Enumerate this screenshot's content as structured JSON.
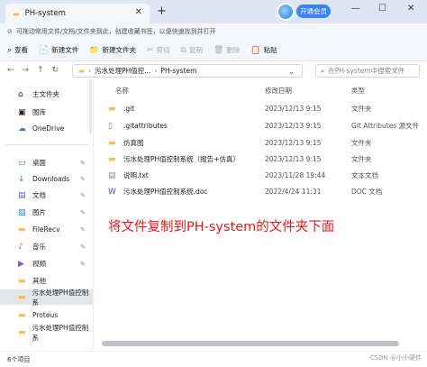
{
  "tab": {
    "title": "PH-system",
    "close": "✕",
    "new": "+"
  },
  "window": {
    "vip_button": "开通会员",
    "minimize": "—",
    "maximize": "☐",
    "close": "✕"
  },
  "banner": {
    "text": "可拖动常用文件/文档/文件夹到此，创建收藏书签，以便快速找到并打开"
  },
  "toolbar": {
    "items": [
      {
        "label": "查看",
        "icon": "⌕"
      },
      {
        "label": "新建文件",
        "icon": "📄"
      },
      {
        "label": "新建文件夹",
        "icon": "📁"
      },
      {
        "label": "剪切",
        "icon": "✂"
      },
      {
        "label": "复制",
        "icon": "⧉"
      },
      {
        "label": "删除",
        "icon": "🗑"
      },
      {
        "label": "粘贴",
        "icon": "📋"
      }
    ]
  },
  "address": {
    "crumbs": [
      "污水处理PH值控...",
      "PH-system"
    ],
    "search_placeholder": "在PH-system中搜索文件"
  },
  "sidebar": {
    "items": [
      {
        "label": "主文件夹",
        "icon": "⌂",
        "pinned": false
      },
      {
        "label": "图库",
        "icon": "▣",
        "pinned": false
      },
      {
        "label": "OneDrive",
        "icon": "☁",
        "pinned": false
      },
      {
        "label": "桌面",
        "icon": "▭",
        "pinned": true
      },
      {
        "label": "Downloads",
        "icon": "↓",
        "pinned": true
      },
      {
        "label": "文档",
        "icon": "▤",
        "pinned": true
      },
      {
        "label": "图片",
        "icon": "▨",
        "pinned": true
      },
      {
        "label": "FileRecv",
        "icon": "▬",
        "pinned": true
      },
      {
        "label": "音乐",
        "icon": "♪",
        "pinned": true
      },
      {
        "label": "视频",
        "icon": "▶",
        "pinned": true
      },
      {
        "label": "其他",
        "icon": "▬",
        "pinned": false
      },
      {
        "label": "污水处理PH值控制系",
        "icon": "▬",
        "pinned": false
      },
      {
        "label": "Proteus",
        "icon": "▬",
        "pinned": false
      },
      {
        "label": "污水处理PH值控制系",
        "icon": "▬",
        "pinned": false
      }
    ]
  },
  "columns": {
    "name": "名称",
    "date": "修改日期",
    "type": "类型"
  },
  "files": [
    {
      "name": ".git",
      "date": "2023/12/13 9:15",
      "type": "文件夹",
      "icon": "folder"
    },
    {
      "name": ".gitattributes",
      "date": "2023/12/13 9:15",
      "type": "Git Attributes 源文件",
      "icon": "file"
    },
    {
      "name": "仿真图",
      "date": "2023/12/13 9:15",
      "type": "文件夹",
      "icon": "folder"
    },
    {
      "name": "污水处理PH值控制系统（报告+仿真）",
      "date": "2023/12/13 9:15",
      "type": "文件夹",
      "icon": "folder"
    },
    {
      "name": "说明.txt",
      "date": "2023/11/28 19:44",
      "type": "文本文档",
      "icon": "file"
    },
    {
      "name": "污水处理PH值控制系统.doc",
      "date": "2022/4/24 11:31",
      "type": "DOC 文档",
      "icon": "doc"
    }
  ],
  "caption": "将文件复制到PH-system的文件夹下面",
  "status": {
    "count": "6个项目"
  },
  "watermark": "CSDN @小小硬件"
}
